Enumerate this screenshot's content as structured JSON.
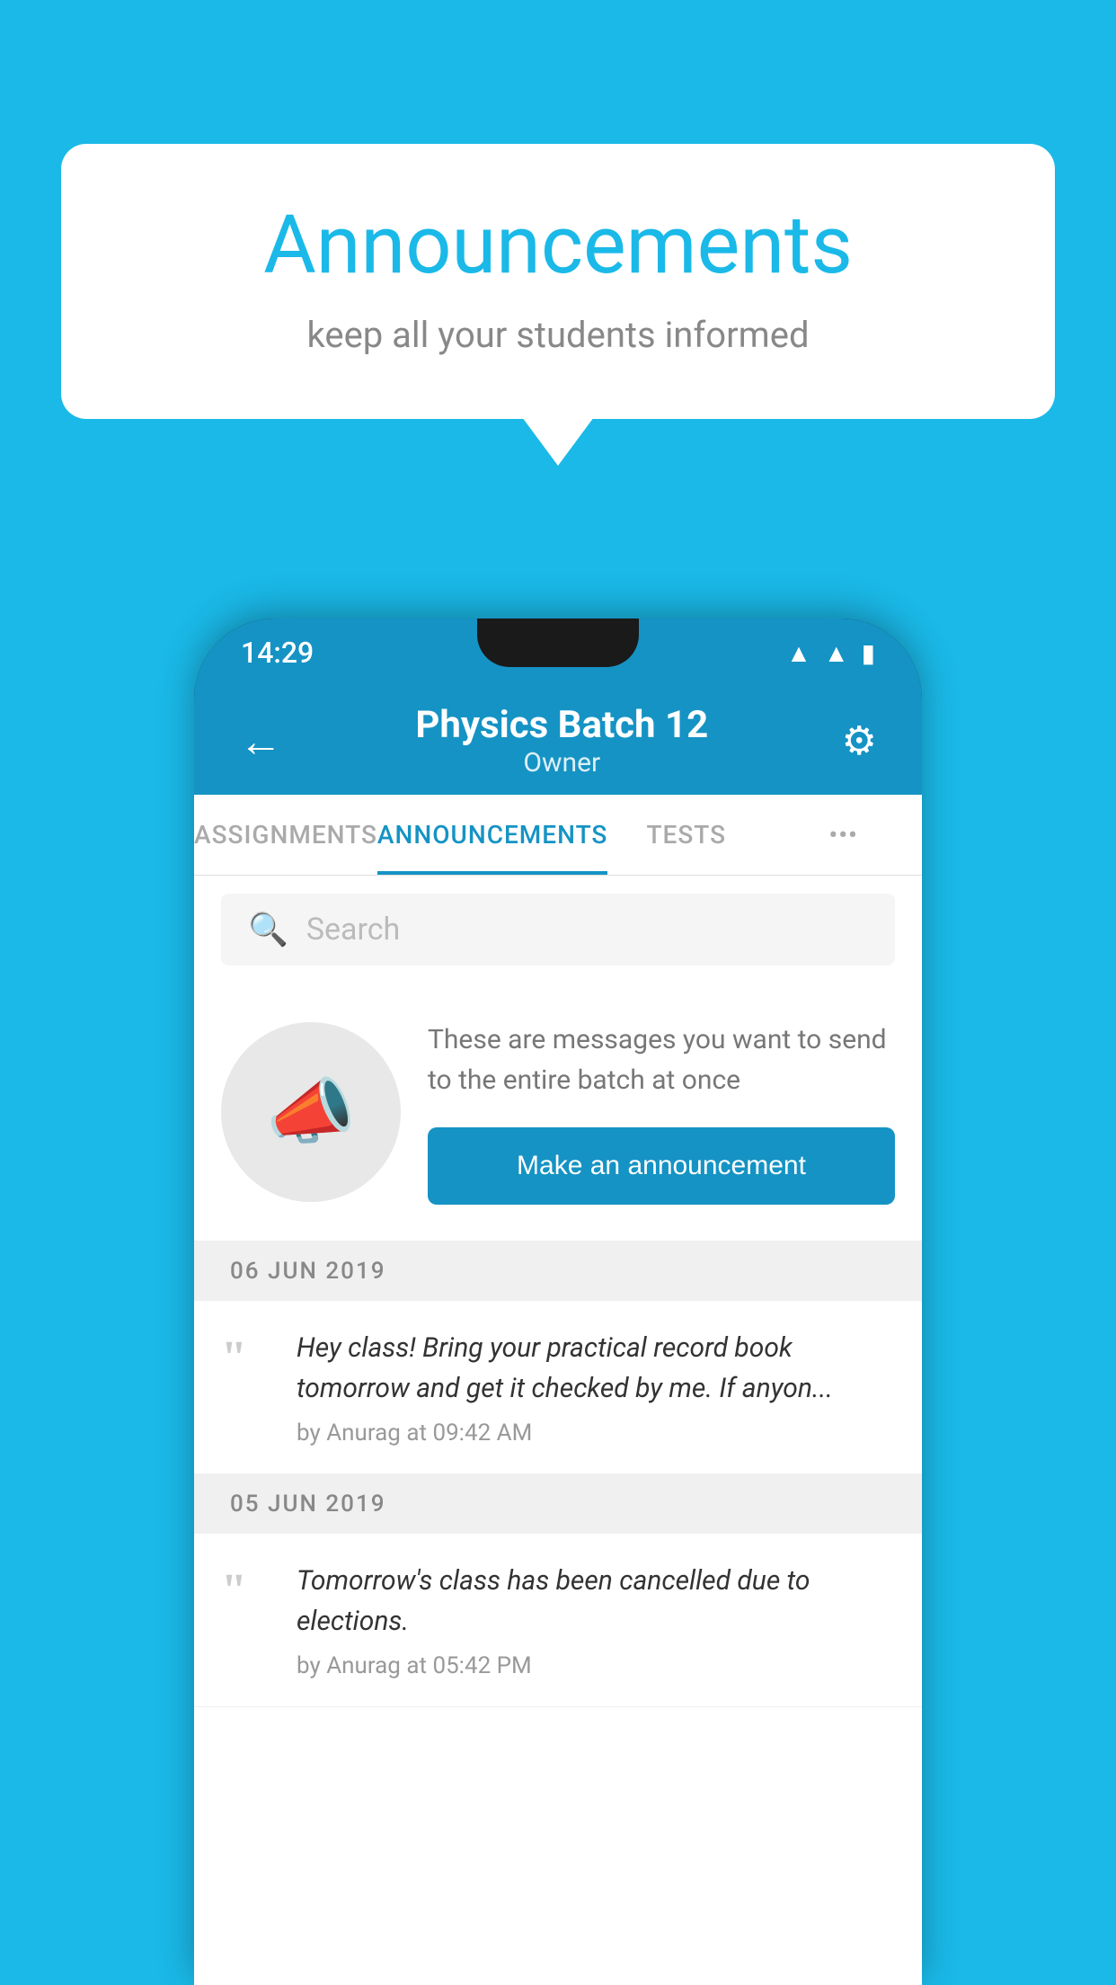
{
  "bubble": {
    "title": "Announcements",
    "subtitle": "keep all your students informed"
  },
  "statusBar": {
    "time": "14:29",
    "icons": [
      "wifi",
      "signal",
      "battery"
    ]
  },
  "appBar": {
    "title": "Physics Batch 12",
    "subtitle": "Owner",
    "backLabel": "←",
    "settingsLabel": "⚙"
  },
  "tabs": [
    {
      "label": "ASSIGNMENTS",
      "active": false
    },
    {
      "label": "ANNOUNCEMENTS",
      "active": true
    },
    {
      "label": "TESTS",
      "active": false
    },
    {
      "label": "•••",
      "active": false
    }
  ],
  "search": {
    "placeholder": "Search"
  },
  "promo": {
    "text": "These are messages you want to send to the entire batch at once",
    "buttonLabel": "Make an announcement"
  },
  "announcements": [
    {
      "date": "06  JUN  2019",
      "text": "Hey class! Bring your practical record book tomorrow and get it checked by me. If anyon...",
      "meta": "by Anurag at 09:42 AM"
    },
    {
      "date": "05  JUN  2019",
      "text": "Tomorrow's class has been cancelled due to elections.",
      "meta": "by Anurag at 05:42 PM"
    }
  ]
}
